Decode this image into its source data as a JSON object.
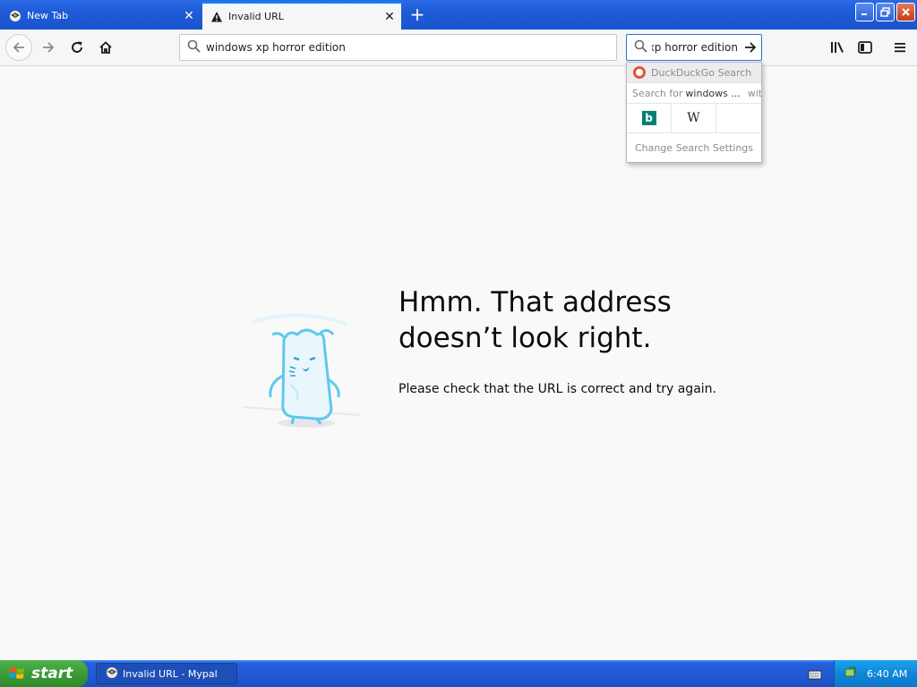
{
  "tabs": [
    {
      "label": "New Tab",
      "icon": "mypal-icon",
      "active": false
    },
    {
      "label": "Invalid URL",
      "icon": "warning-icon",
      "active": true
    }
  ],
  "navbar": {
    "url_value": "windows xp horror edition",
    "search_value": "windows xp horror edition"
  },
  "search_popup": {
    "engine_name": "DuckDuckGo Search",
    "search_for_label": "Search for",
    "query_preview": "windows ...",
    "with_label": "with:",
    "engines": [
      "bing-icon",
      "wikipedia-icon",
      ""
    ],
    "wiki_glyph": "W",
    "bing_glyph": "b",
    "settings_label": "Change Search Settings"
  },
  "error": {
    "title": "Hmm. That address doesn’t look right.",
    "description": "Please check that the URL is correct and try again."
  },
  "taskbar": {
    "start_label": "start",
    "task_label": "Invalid URL - Mypal",
    "clock": "6:40 AM"
  },
  "colors": {
    "accent": "#0a84ff",
    "taskbar_blue": "#245edb",
    "start_green": "#3c9b36",
    "illustration": "#5fc8ee"
  }
}
